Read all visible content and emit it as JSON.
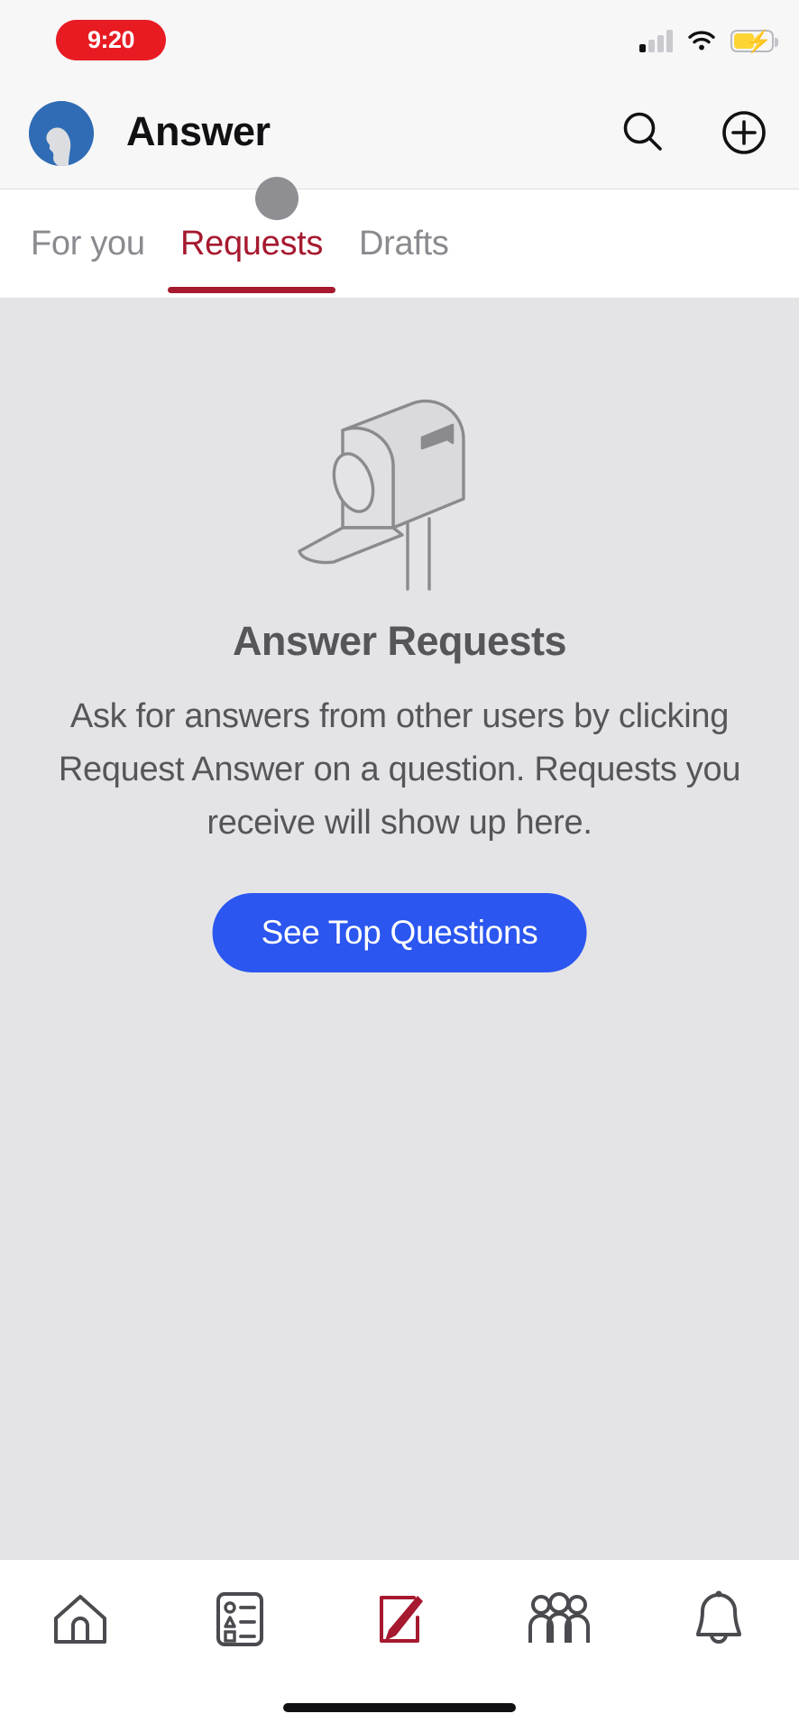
{
  "status_bar": {
    "time": "9:20",
    "recording_pill_color": "#e81b23",
    "signal_icon": "cellular-signal-icon",
    "signal_bars_total": 4,
    "signal_bars_active": 1,
    "wifi_icon": "wifi-icon",
    "battery_icon": "battery-charging-icon",
    "battery_fill_color": "#fcd535",
    "battery_charging": true
  },
  "header": {
    "logo_icon": "answer-avatar-logo",
    "title": "Answer",
    "search_icon": "search-icon",
    "add_icon": "plus-circle-icon"
  },
  "tabs": {
    "items": [
      {
        "label": "For you",
        "active": false
      },
      {
        "label": "Requests",
        "active": true
      },
      {
        "label": "Drafts",
        "active": false
      }
    ],
    "active_color": "#a6192e",
    "inactive_color": "#8a8a8f",
    "touch_indicator": "touch-pointer-dot"
  },
  "empty_state": {
    "illustration_icon": "mailbox-illustration",
    "title": "Answer Requests",
    "body": "Ask for answers from other users by clicking Request Answer on a question. Requests you receive will show up here.",
    "cta_label": "See Top Questions",
    "cta_color": "#2b56f0",
    "background_color": "#e4e4e6"
  },
  "bottom_nav": {
    "items": [
      {
        "icon": "home-icon",
        "active": false
      },
      {
        "icon": "answer-list-icon",
        "active": false
      },
      {
        "icon": "write-pencil-icon",
        "active": true
      },
      {
        "icon": "spaces-people-icon",
        "active": false
      },
      {
        "icon": "notifications-bell-icon",
        "active": false
      }
    ],
    "active_color": "#a6192e",
    "inactive_color": "#4a4a4f",
    "home_indicator": "home-indicator-bar"
  }
}
